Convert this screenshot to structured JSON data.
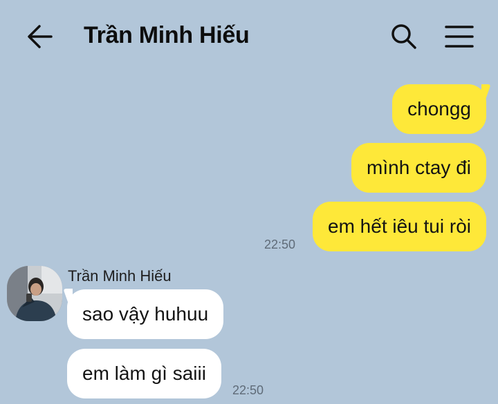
{
  "header": {
    "title": "Trần Minh Hiếu"
  },
  "outgoing": {
    "messages": [
      "chongg",
      "mình ctay đi",
      "em hết iêu tui ròi"
    ],
    "time": "22:50"
  },
  "incoming": {
    "sender": "Trần Minh Hiếu",
    "messages": [
      "sao vậy huhuu",
      "em làm gì saiii"
    ],
    "time": "22:50"
  },
  "colors": {
    "background": "#b2c6d9",
    "outgoing_bubble": "#fee839",
    "incoming_bubble": "#ffffff"
  },
  "icons": {
    "back": "arrow-left-icon",
    "search": "search-icon",
    "menu": "hamburger-menu-icon"
  }
}
